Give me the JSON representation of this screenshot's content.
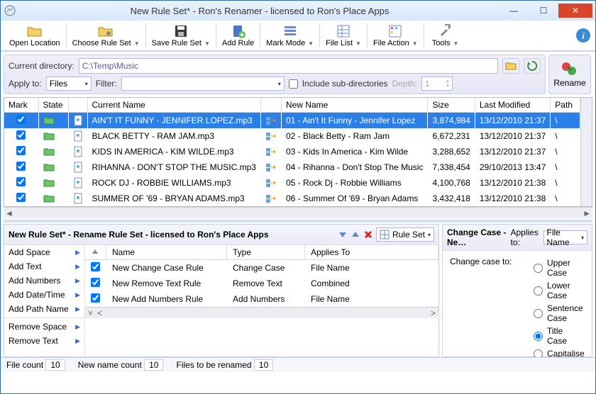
{
  "window": {
    "title": "New Rule Set* - Ron's Renamer - licensed to Ron's Place Apps"
  },
  "toolbar": {
    "open_location": "Open Location",
    "choose_rule_set": "Choose Rule Set",
    "save_rule_set": "Save Rule Set",
    "add_rule": "Add Rule",
    "mark_mode": "Mark Mode",
    "file_list": "File List",
    "file_action": "File Action",
    "tools": "Tools"
  },
  "options": {
    "current_directory_label": "Current directory:",
    "current_directory_value": "C:\\Temp\\Music",
    "apply_to_label": "Apply to:",
    "apply_to_value": "Files",
    "filter_label": "Filter:",
    "filter_value": "",
    "include_sub_label": "Include sub-directories",
    "depth_label": "Depth:",
    "depth_value": "1",
    "rename_label": "Rename"
  },
  "columns": {
    "mark": "Mark",
    "state": "State",
    "current_name": "Current Name",
    "new_name": "New Name",
    "size": "Size",
    "last_modified": "Last Modified",
    "path": "Path"
  },
  "files": [
    {
      "mark": true,
      "current": "AIN'T IT FUNNY - JENNIFER LOPEZ.mp3",
      "new": "01 - Ain't It Funny - Jennifer Lopez",
      "size": "3,874,984",
      "modified": "13/12/2010 21:37",
      "path": "\\",
      "selected": true
    },
    {
      "mark": true,
      "current": "BLACK BETTY - RAM JAM.mp3",
      "new": "02 - Black Betty - Ram Jam",
      "size": "6,672,231",
      "modified": "13/12/2010 21:37",
      "path": "\\"
    },
    {
      "mark": true,
      "current": "KIDS IN AMERICA - KIM WILDE.mp3",
      "new": "03 - Kids In America - Kim Wilde",
      "size": "3,288,652",
      "modified": "13/12/2010 21:37",
      "path": "\\"
    },
    {
      "mark": true,
      "current": "RIHANNA - DON'T STOP THE MUSIC.mp3",
      "new": "04 - Rihanna - Don't Stop The Music",
      "size": "7,338,454",
      "modified": "29/10/2013 13:47",
      "path": "\\"
    },
    {
      "mark": true,
      "current": "ROCK DJ - ROBBIE WILLIAMS.mp3",
      "new": "05 - Rock Dj - Robbie Williams",
      "size": "4,100,768",
      "modified": "13/12/2010 21:38",
      "path": "\\"
    },
    {
      "mark": true,
      "current": "SUMMER OF '69 - BRYAN ADAMS.mp3",
      "new": "06 - Summer Of '69 - Bryan Adams",
      "size": "3,432,418",
      "modified": "13/12/2010 21:38",
      "path": "\\"
    }
  ],
  "rule_panel": {
    "header": "New Rule Set* - Rename Rule Set - licensed to Ron's Place Apps",
    "rule_set_btn": "Rule Set",
    "actions": [
      "Add Space",
      "Add Text",
      "Add Numbers",
      "Add Date/Time",
      "Add Path Name",
      "Remove Space",
      "Remove Text"
    ],
    "columns": {
      "name": "Name",
      "type": "Type",
      "applies_to": "Applies To"
    },
    "rules": [
      {
        "checked": true,
        "name": "New Change Case Rule",
        "type": "Change Case",
        "applies": "File Name"
      },
      {
        "checked": true,
        "name": "New Remove Text Rule",
        "type": "Remove Text",
        "applies": "Combined"
      },
      {
        "checked": true,
        "name": "New Add Numbers Rule",
        "type": "Add Numbers",
        "applies": "File Name"
      }
    ]
  },
  "props_panel": {
    "header": "Change Case - Ne…",
    "applies_to_label": "Applies to:",
    "applies_to_value": "File Name",
    "field_label": "Change case to:",
    "options": [
      "Upper Case",
      "Lower Case",
      "Sentence Case",
      "Title Case",
      "Capitalise"
    ],
    "selected": "Title Case"
  },
  "status": {
    "file_count_label": "File count",
    "file_count": "10",
    "new_name_count_label": "New name count",
    "new_name_count": "10",
    "to_rename_label": "Files to be renamed",
    "to_rename": "10"
  }
}
